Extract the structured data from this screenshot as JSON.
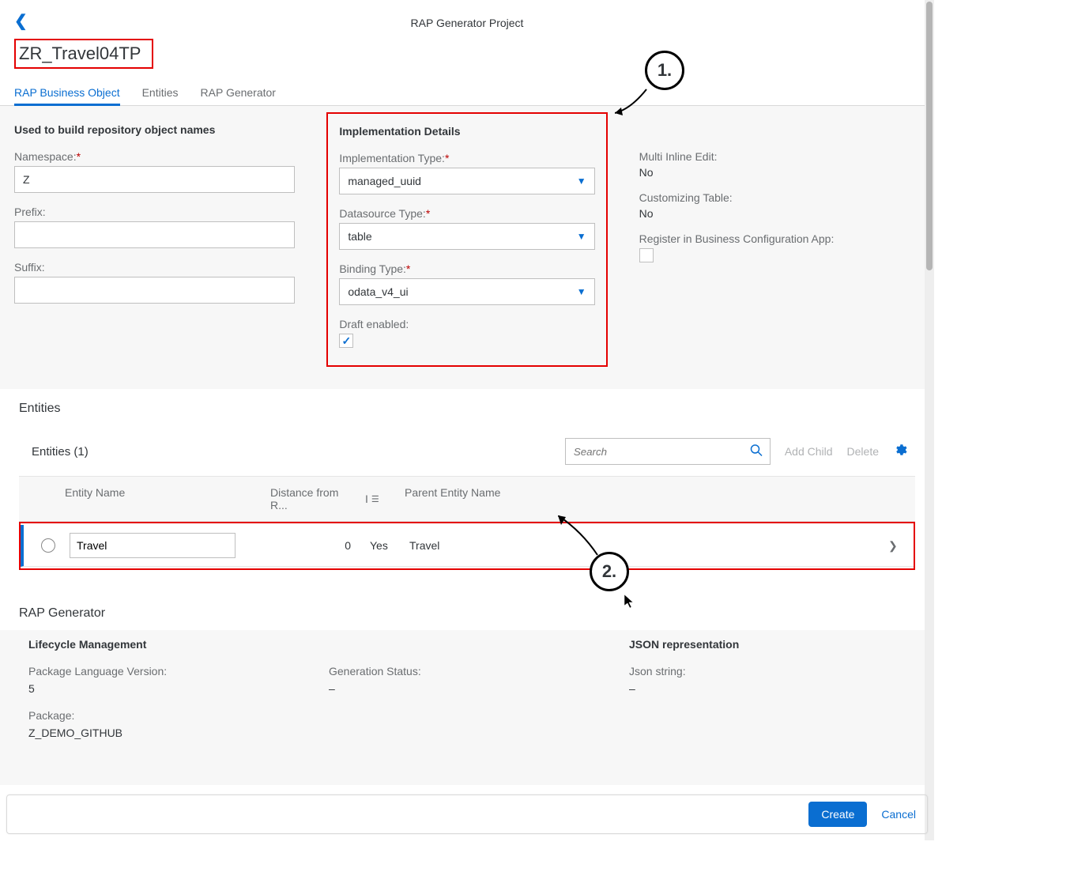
{
  "header": {
    "title": "RAP Generator Project",
    "object_title": "ZR_Travel04TP"
  },
  "tabs": [
    {
      "label": "RAP Business Object",
      "active": true
    },
    {
      "label": "Entities",
      "active": false
    },
    {
      "label": "RAP Generator",
      "active": false
    }
  ],
  "form": {
    "names_section_title": "Used to build repository object names",
    "namespace_label": "Namespace:",
    "namespace_value": "Z",
    "prefix_label": "Prefix:",
    "prefix_value": "",
    "suffix_label": "Suffix:",
    "suffix_value": "",
    "impl_section_title": "Implementation Details",
    "impl_type_label": "Implementation Type:",
    "impl_type_value": "managed_uuid",
    "ds_type_label": "Datasource Type:",
    "ds_type_value": "table",
    "binding_type_label": "Binding Type:",
    "binding_type_value": "odata_v4_ui",
    "draft_label": "Draft enabled:",
    "draft_checked": true,
    "multi_inline_label": "Multi Inline Edit:",
    "multi_inline_value": "No",
    "cust_table_label": "Customizing Table:",
    "cust_table_value": "No",
    "register_label": "Register in Business Configuration App:",
    "register_checked": false
  },
  "entities": {
    "section_title": "Entities",
    "table_title": "Entities (1)",
    "search_placeholder": "Search",
    "add_child_label": "Add Child",
    "delete_label": "Delete",
    "columns": {
      "name": "Entity Name",
      "distance": "Distance from R...",
      "is_root": "I",
      "parent": "Parent Entity Name"
    },
    "rows": [
      {
        "name": "Travel",
        "distance": "0",
        "is_root": "Yes",
        "parent": "Travel"
      }
    ]
  },
  "rap_generator": {
    "section_title": "RAP Generator",
    "lifecycle_title": "Lifecycle Management",
    "pkg_lang_label": "Package Language Version:",
    "pkg_lang_value": "5",
    "pkg_label": "Package:",
    "pkg_value": "Z_DEMO_GITHUB",
    "gen_status_label": "Generation Status:",
    "gen_status_value": "–",
    "json_title": "JSON representation",
    "json_label": "Json string:",
    "json_value": "–"
  },
  "footer": {
    "create": "Create",
    "cancel": "Cancel"
  },
  "annotations": {
    "c1": "1.",
    "c2": "2."
  }
}
